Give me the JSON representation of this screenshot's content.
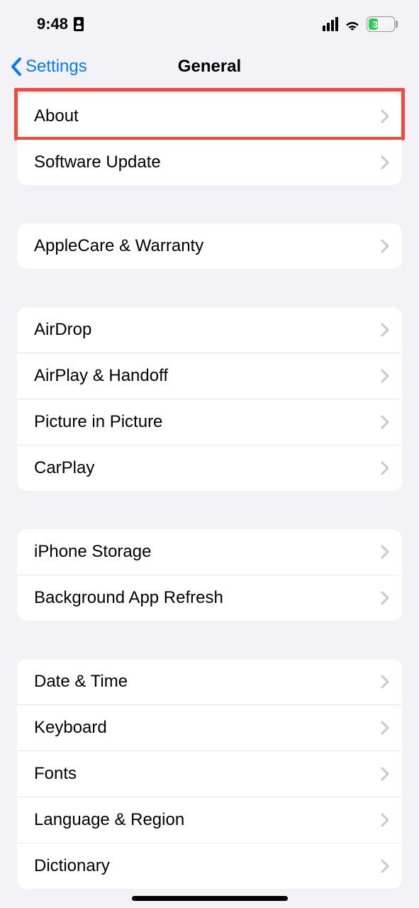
{
  "status": {
    "time": "9:48",
    "battery": "34"
  },
  "nav": {
    "back": "Settings",
    "title": "General"
  },
  "groups": {
    "g1": {
      "about": "About",
      "software_update": "Software Update"
    },
    "g2": {
      "applecare": "AppleCare & Warranty"
    },
    "g3": {
      "airdrop": "AirDrop",
      "airplay": "AirPlay & Handoff",
      "pip": "Picture in Picture",
      "carplay": "CarPlay"
    },
    "g4": {
      "storage": "iPhone Storage",
      "bg_refresh": "Background App Refresh"
    },
    "g5": {
      "date_time": "Date & Time",
      "keyboard": "Keyboard",
      "fonts": "Fonts",
      "language": "Language & Region",
      "dictionary": "Dictionary"
    }
  }
}
